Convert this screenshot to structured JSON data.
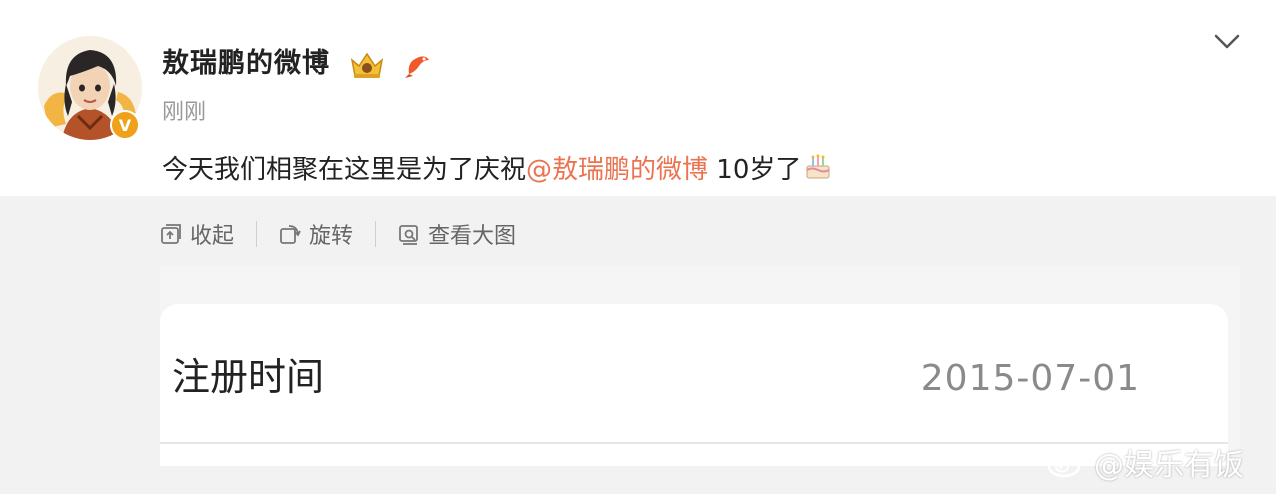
{
  "post": {
    "username": "敖瑞鹏的微博",
    "timestamp": "刚刚",
    "text_before": "今天我们相聚在这里是为了庆祝",
    "mention": "@敖瑞鹏的微博",
    "text_after": " 10岁了",
    "verified_badge": "V",
    "mention_color": "#eb7350",
    "badge_color": "#f0a11b"
  },
  "toolbar": {
    "collapse_label": "收起",
    "rotate_label": "旋转",
    "view_large_label": "查看大图"
  },
  "image": {
    "registration_label": "注册时间",
    "registration_date": "2015-07-01"
  },
  "watermark": {
    "text": "@娱乐有饭"
  },
  "icons": [
    "crown-icon",
    "koi-fish-icon",
    "chevron-down-icon",
    "cake-icon",
    "collapse-icon",
    "rotate-icon",
    "view-large-icon",
    "weibo-logo-icon"
  ]
}
